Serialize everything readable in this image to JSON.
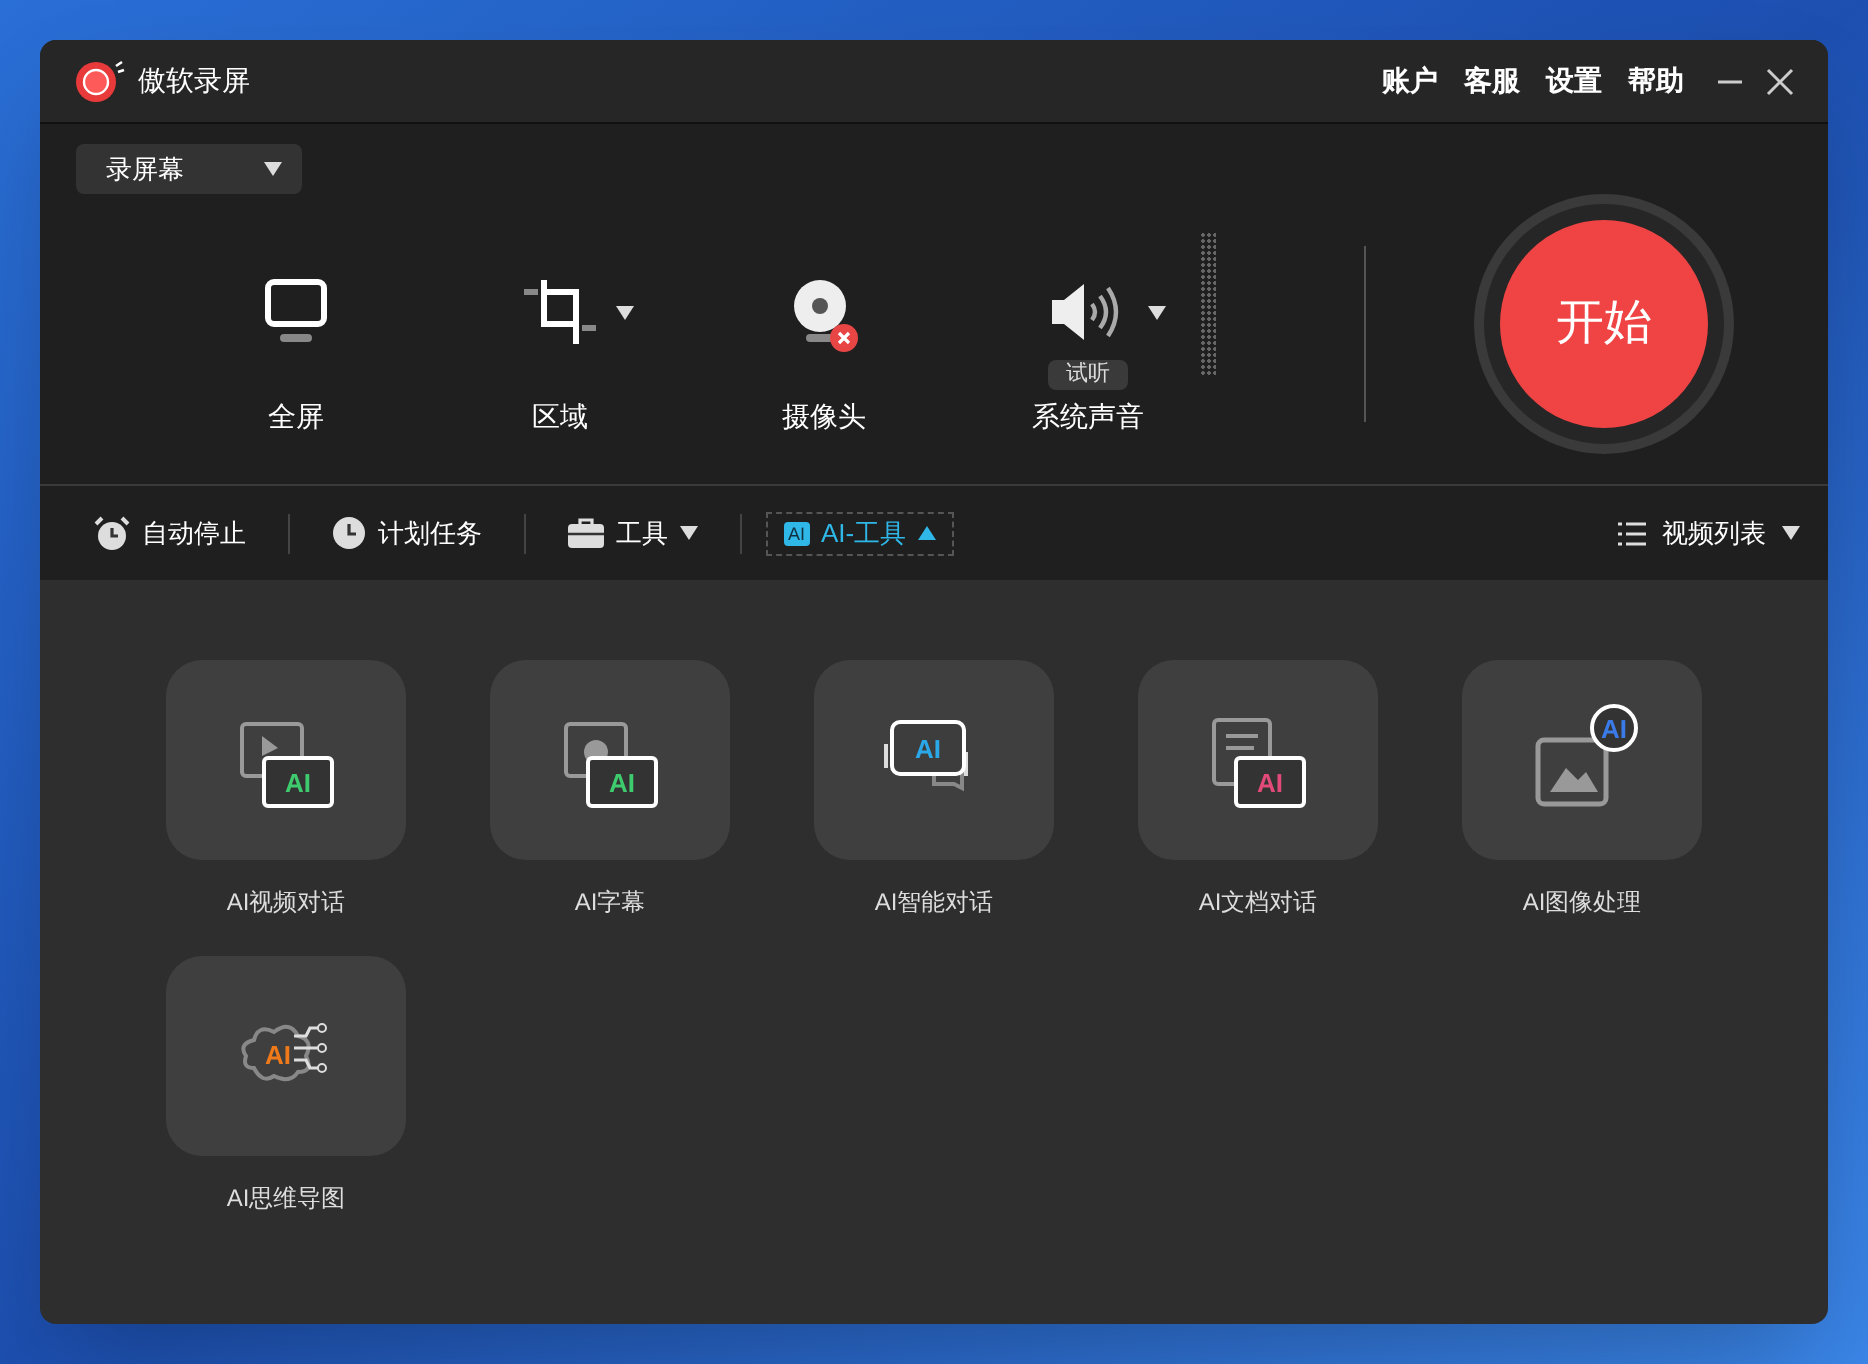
{
  "window": {
    "title": "傲软录屏",
    "menu": [
      {
        "label": "账户"
      },
      {
        "label": "客服"
      },
      {
        "label": "设置"
      },
      {
        "label": "帮助"
      }
    ]
  },
  "mode_dropdown": {
    "value": "录屏幕"
  },
  "sources": [
    {
      "kind": "screen",
      "label": "全屏",
      "dropdown": false,
      "disabled": false
    },
    {
      "kind": "region",
      "label": "区域",
      "dropdown": true,
      "disabled": false
    },
    {
      "kind": "camera",
      "label": "摄像头",
      "dropdown": false,
      "disabled": true
    },
    {
      "kind": "audio",
      "label": "系统声音",
      "dropdown": true,
      "disabled": false,
      "preview": "试听"
    }
  ],
  "start_button": {
    "label": "开始"
  },
  "toolbar": [
    {
      "kind": "alarm",
      "label": "自动停止",
      "selected": false
    },
    {
      "kind": "clock",
      "label": "计划任务",
      "selected": false
    },
    {
      "kind": "toolbox",
      "label": "工具",
      "selected": false,
      "expanded": false
    },
    {
      "kind": "ai",
      "label": "AI-工具",
      "icon_text": "AI",
      "selected": true,
      "expanded": true
    }
  ],
  "video_list": {
    "label": "视频列表",
    "expanded": false
  },
  "tools": [
    {
      "kind": "video",
      "label": "AI视频对话",
      "icon_text": "AI"
    },
    {
      "kind": "subtitle",
      "label": "AI字幕",
      "icon_text": "AI"
    },
    {
      "kind": "chat",
      "label": "AI智能对话",
      "icon_text": "AI"
    },
    {
      "kind": "document",
      "label": "AI文档对话",
      "icon_text": "AI"
    },
    {
      "kind": "image",
      "label": "AI图像处理",
      "icon_text": "AI"
    },
    {
      "kind": "mindmap",
      "label": "AI思维导图",
      "icon_text": "AI"
    }
  ]
}
